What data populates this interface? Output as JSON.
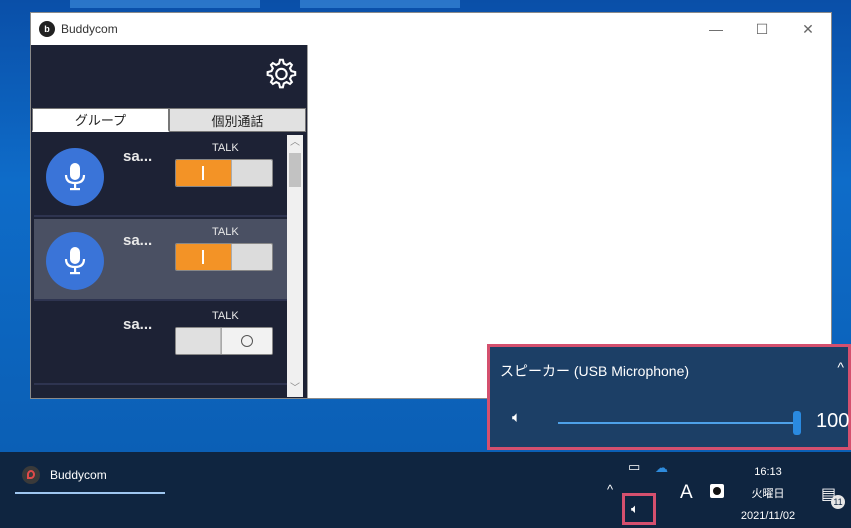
{
  "window": {
    "title": "Buddycom",
    "controls": [
      "—",
      "☐",
      "✕"
    ]
  },
  "app": {
    "tabs": [
      {
        "label": "グループ"
      },
      {
        "label": "個別通話"
      }
    ],
    "groups": [
      {
        "name": "sa...",
        "talk_label": "TALK",
        "toggle": "on",
        "mic": true
      },
      {
        "name": "sa...",
        "talk_label": "TALK",
        "toggle": "on",
        "mic": true
      },
      {
        "name": "sa...",
        "talk_label": "TALK",
        "toggle": "off",
        "mic": false
      }
    ]
  },
  "volume": {
    "device": "スピーカー (USB Microphone)",
    "value": "100",
    "level": 1.0,
    "chevron": "^"
  },
  "taskbar": {
    "app_label": "Buddycom",
    "tray_chevron": "^",
    "ime": "A",
    "time": "16:13",
    "weekday": "火曜日",
    "date": "2021/11/02",
    "notifications": "11"
  },
  "colors": {
    "accent_orange": "#f39326",
    "avatar_blue": "#3a74d8",
    "highlight": "#d4506e"
  }
}
